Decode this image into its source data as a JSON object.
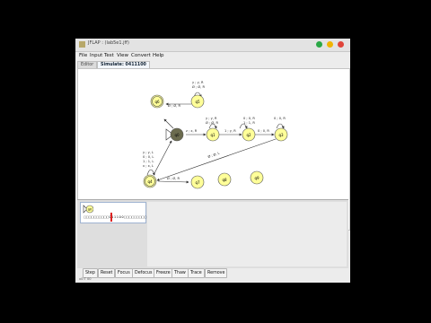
{
  "window": {
    "title": "JFLAP : (lab5e1.jff)"
  },
  "menu": [
    "File",
    "Input",
    "Test",
    "View",
    "Convert",
    "Help"
  ],
  "tabs": [
    {
      "label": "Editor",
      "active": false
    },
    {
      "label": "Simulate: 0411100",
      "active": true
    }
  ],
  "states": [
    {
      "id": "q0",
      "label": "q0",
      "initial": true,
      "current": true
    },
    {
      "id": "q1",
      "label": "q1"
    },
    {
      "id": "q2",
      "label": "q2"
    },
    {
      "id": "q3",
      "label": "q3"
    },
    {
      "id": "q4",
      "label": "q4",
      "final": true
    },
    {
      "id": "q5",
      "label": "q5"
    },
    {
      "id": "q6",
      "label": "q6",
      "final": true
    },
    {
      "id": "q7",
      "label": "q7"
    },
    {
      "id": "q8",
      "label": "q8"
    },
    {
      "id": "q9",
      "label": "q9"
    }
  ],
  "transitions": [
    {
      "from": "q0",
      "to": "q1",
      "label": "z ; x, R"
    },
    {
      "from": "q1",
      "to": "q2",
      "label": "1 ; y, R"
    },
    {
      "from": "q2",
      "to": "q3",
      "label": "0 ; 0, R"
    },
    {
      "from": "q3",
      "to": "q4",
      "label": "Ø ; Ø, L"
    },
    {
      "from": "q4",
      "to": "q0",
      "label": "x ; x, R"
    },
    {
      "from": "q0",
      "to": "q5",
      "label": "Ø ; Ø, R"
    },
    {
      "from": "q5",
      "to": "q6",
      "label": "Ø ; Ø, R"
    },
    {
      "from": "q4",
      "to": "q7",
      "label": "Ø ; Ø, R"
    }
  ],
  "loops": [
    {
      "state": "q5",
      "labels": [
        "y ; y, R",
        "Ø ; Ø, R"
      ]
    },
    {
      "state": "q2",
      "labels": [
        "y ; y, R",
        "Ø ; Ø, R"
      ]
    },
    {
      "state": "q3",
      "labels": [
        "0 ; 0, R",
        "1 ; 1, R"
      ]
    },
    {
      "state": "q4",
      "labels": [
        "0 ; 0, R"
      ]
    },
    {
      "state": "q7",
      "labels": [
        "y ; y, L",
        "0 ; 0, L",
        "1 ; 1, L",
        "x ; x, L"
      ]
    }
  ],
  "simulation": {
    "current_state": "q0",
    "tape": [
      "□",
      "□",
      "□",
      "□",
      "□",
      "□",
      "□",
      "□",
      "□",
      "□",
      "0",
      "1",
      "1",
      "1",
      "0",
      "0",
      "□",
      "□",
      "□",
      "□",
      "□",
      "□",
      "□",
      "□",
      "□"
    ],
    "head_index": 10
  },
  "buttons": [
    "Step",
    "Reset",
    "Focus",
    "Defocus",
    "Freeze",
    "Thaw",
    "Trace",
    "Remove"
  ],
  "status": "x0:T 00"
}
